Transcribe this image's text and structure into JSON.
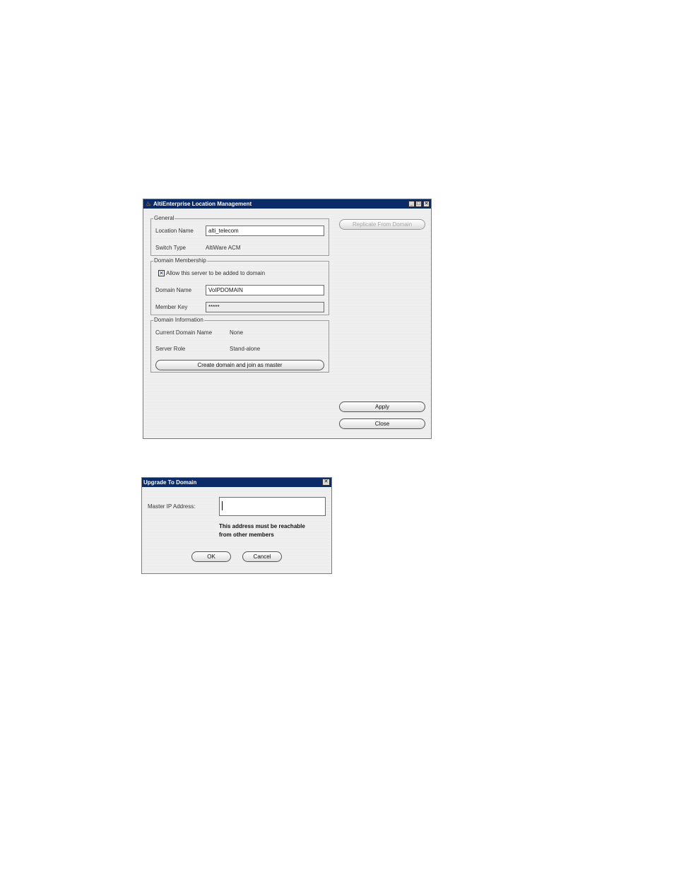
{
  "location_window": {
    "title": "AltiEnterprise Location Management",
    "controls": {
      "minimize": "_",
      "maximize": "□",
      "close": "✕"
    },
    "general": {
      "legend": "General",
      "location_name_label": "Location Name",
      "location_name_value": "alti_telecom",
      "switch_type_label": "Switch Type",
      "switch_type_value": "AltiWare ACM"
    },
    "domain_membership": {
      "legend": "Domain Membership",
      "allow_checkbox_mark": "✕",
      "allow_label": "Allow this server to be added to domain",
      "domain_name_label": "Domain Name",
      "domain_name_value": "VoIPDOMAIN",
      "member_key_label": "Member Key",
      "member_key_value": "*****"
    },
    "domain_information": {
      "legend": "Domain Information",
      "current_domain_label": "Current Domain Name",
      "current_domain_value": "None",
      "server_role_label": "Server Role",
      "server_role_value": "Stand-alone",
      "create_button": "Create domain and join as master"
    },
    "replicate_button": "Replicate From Domain",
    "apply_button": "Apply",
    "close_button": "Close"
  },
  "upgrade_dialog": {
    "title": "Upgrade To Domain",
    "close": "✕",
    "master_ip_label": "Master IP Address:",
    "master_ip_value": "",
    "hint_line1": "This address must be reachable",
    "hint_line2": "from other members",
    "ok_button": "OK",
    "cancel_button": "Cancel"
  }
}
